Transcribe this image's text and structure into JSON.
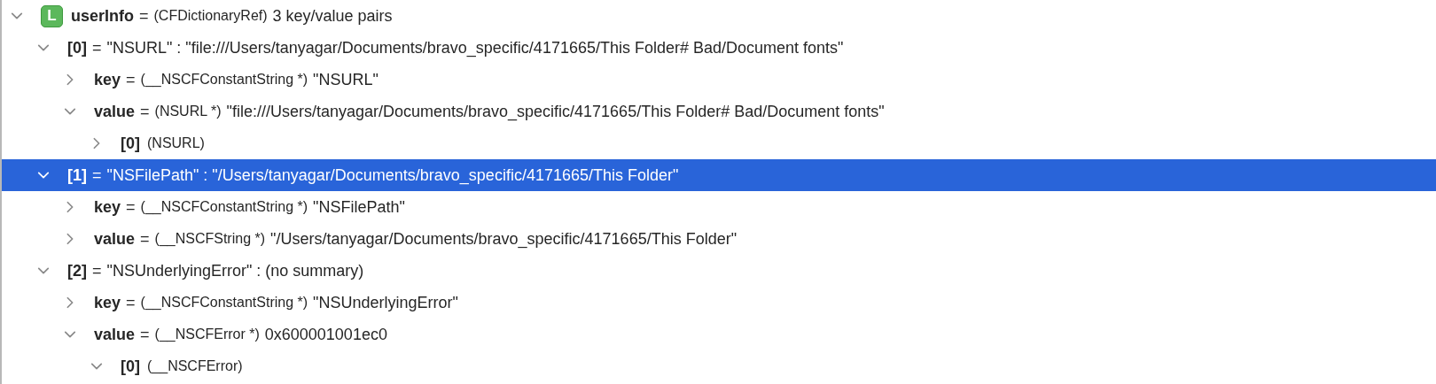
{
  "variables": [
    {
      "badge": "L",
      "name": "userInfo",
      "operator": "=",
      "type": "(CFDictionaryRef)",
      "value": "3 key/value pairs",
      "expanded": true,
      "selected": false,
      "children": [
        {
          "name": "[0]",
          "operator": "=",
          "value": "\"NSURL\" : \"file:///Users/tanyagar/Documents/bravo_specific/4171665/This Folder# Bad/Document fonts\"",
          "expanded": true,
          "selected": false,
          "children": [
            {
              "name": "key",
              "operator": "=",
              "type": "(__NSCFConstantString *)",
              "value": "\"NSURL\"",
              "expanded": false,
              "selected": false
            },
            {
              "name": "value",
              "operator": "=",
              "type": "(NSURL *)",
              "value": "\"file:///Users/tanyagar/Documents/bravo_specific/4171665/This Folder# Bad/Document fonts\"",
              "expanded": true,
              "selected": false,
              "children": [
                {
                  "name": "[0]",
                  "type": "(NSURL)",
                  "expanded": false,
                  "selected": false
                }
              ]
            }
          ]
        },
        {
          "name": "[1]",
          "operator": "=",
          "value": "\"NSFilePath\" : \"/Users/tanyagar/Documents/bravo_specific/4171665/This Folder\"",
          "expanded": true,
          "selected": true,
          "children": [
            {
              "name": "key",
              "operator": "=",
              "type": "(__NSCFConstantString *)",
              "value": "\"NSFilePath\"",
              "expanded": false,
              "selected": false
            },
            {
              "name": "value",
              "operator": "=",
              "type": "(__NSCFString *)",
              "value": "\"/Users/tanyagar/Documents/bravo_specific/4171665/This Folder\"",
              "expanded": false,
              "selected": false
            }
          ]
        },
        {
          "name": "[2]",
          "operator": "=",
          "value": "\"NSUnderlyingError\" : (no summary)",
          "expanded": true,
          "selected": false,
          "children": [
            {
              "name": "key",
              "operator": "=",
              "type": "(__NSCFConstantString *)",
              "value": "\"NSUnderlyingError\"",
              "expanded": false,
              "selected": false
            },
            {
              "name": "value",
              "operator": "=",
              "type": "(__NSCFError *)",
              "value": "0x600001001ec0",
              "expanded": true,
              "selected": false,
              "children": [
                {
                  "name": "[0]",
                  "type": "(__NSCFError)",
                  "expanded": true,
                  "selected": false
                }
              ]
            }
          ]
        }
      ]
    }
  ]
}
